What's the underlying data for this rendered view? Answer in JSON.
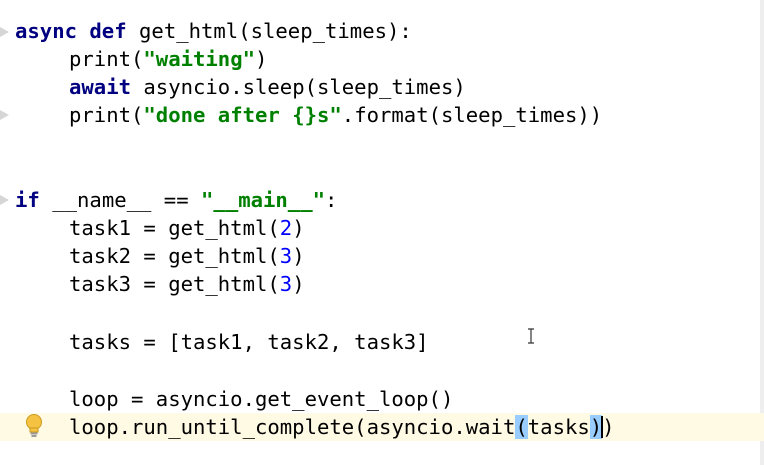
{
  "editor": {
    "language": "python",
    "lines": {
      "def_kw1": "async",
      "def_kw2": "def",
      "def_sig": "get_html(sleep_times):",
      "print1_fn": "print(",
      "print1_str": "\"waiting\"",
      "print1_end": ")",
      "await_kw": "await",
      "await_rest": "asyncio.sleep(sleep_times)",
      "print2_fn": "print(",
      "print2_str": "\"done after {}s\"",
      "print2_rest": ".format(sleep_times))",
      "if_kw": "if",
      "if_mid": "__name__ == ",
      "if_str": "\"__main__\"",
      "if_end": ":",
      "task1_pre": "task1 = get_html(",
      "task1_num": "2",
      "task1_end": ")",
      "task2_pre": "task2 = get_html(",
      "task2_num": "3",
      "task2_end": ")",
      "task3_pre": "task3 = get_html(",
      "task3_num": "3",
      "task3_end": ")",
      "tasks": "tasks = [task1, task2, task3]",
      "loop": "loop = asyncio.get_event_loop()",
      "run_pre": "loop.run_until_complete(asyncio.wait",
      "run_paren_open": "(",
      "run_arg": "tasks",
      "run_paren_close": ")",
      "run_end": ")"
    },
    "colors": {
      "keyword": "#000080",
      "string": "#008000",
      "number": "#0000ff",
      "current_line": "#fffae3",
      "bracket_match": "#99ccff"
    },
    "icons": [
      "intention-bulb-icon",
      "text-cursor-icon",
      "fold-marker-icon"
    ]
  }
}
